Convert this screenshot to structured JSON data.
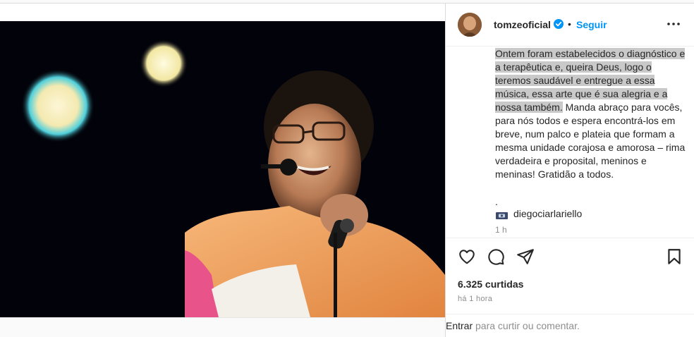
{
  "post": {
    "username": "tomzeoficial",
    "separator": "•",
    "follow_label": "Seguir",
    "caption_highlighted": "Ontem foram estabelecidos o diagnóstico e a terapêutica e, queira Deus, logo o teremos saudável e entregue a essa música, essa arte que é sua alegria e a nossa também.",
    "caption_rest": "Manda abraço para vocês, para nós todos e espera encontrá-los em breve, num palco e plateia que formam a mesma unidade corajosa e amorosa – rima verdadeira e proposital, meninos e meninas! Gratidão a todos.",
    "caption_dot": ".",
    "photo_credit": "diegociarlariello",
    "caption_time": "1 h",
    "likes": "6.325 curtidas",
    "posted_time": "há 1 hora",
    "comment_login": "Entrar",
    "comment_prompt": " para curtir ou comentar."
  },
  "icons": {
    "verified": "verified-badge-icon",
    "more": "more-options-icon",
    "like": "heart-icon",
    "comment": "comment-icon",
    "share": "share-icon",
    "save": "bookmark-icon",
    "credit": "camera-flag-icon"
  },
  "colors": {
    "accent": "#0095f6",
    "text": "#262626",
    "muted": "#8e8e8e",
    "highlight": "#c9c9c9"
  }
}
